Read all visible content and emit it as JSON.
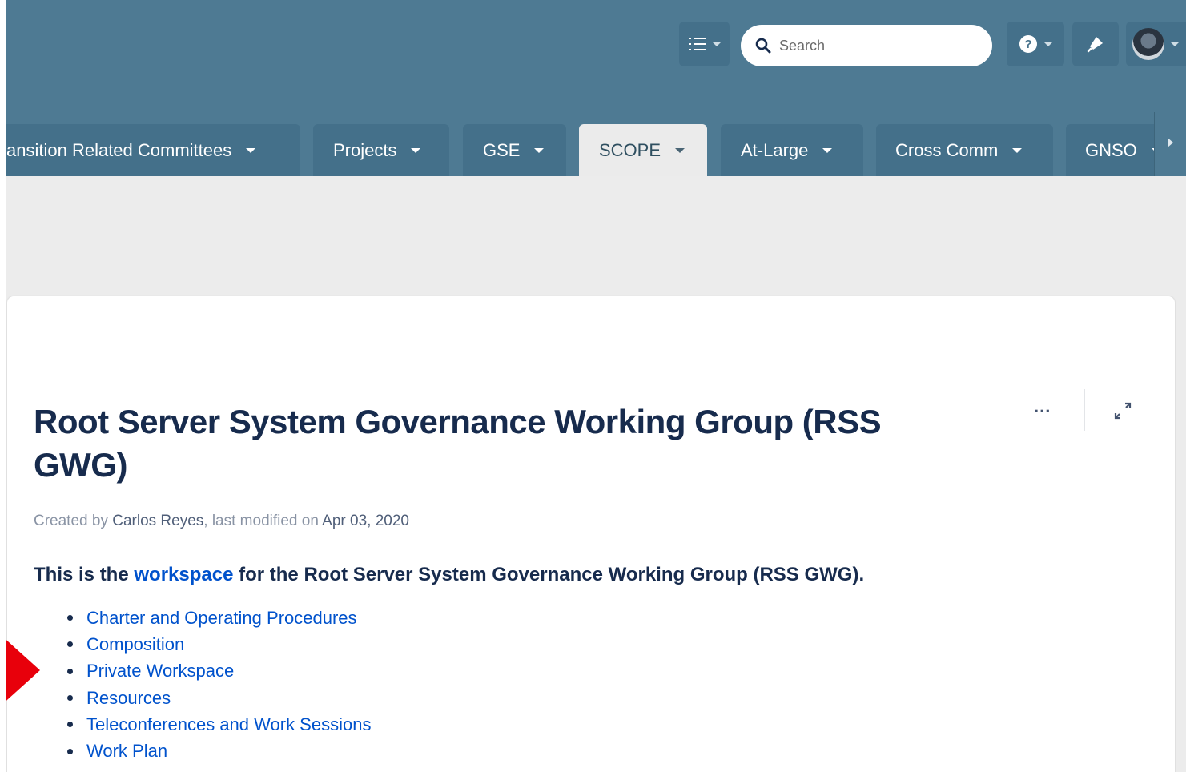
{
  "header": {
    "search_placeholder": "Search"
  },
  "tabs": [
    {
      "label": "ansition Related Committees",
      "active": false
    },
    {
      "label": "Projects",
      "active": false
    },
    {
      "label": "GSE",
      "active": false
    },
    {
      "label": "SCOPE",
      "active": true
    },
    {
      "label": "At-Large",
      "active": false
    },
    {
      "label": "Cross Comm",
      "active": false
    },
    {
      "label": "GNSO",
      "active": false
    }
  ],
  "page": {
    "title": "Root Server System Governance Working Group (RSS GWG)",
    "byline": {
      "created_by_label": "Created by",
      "author": "Carlos Reyes",
      "modified_label": ", last modified on",
      "date": "Apr 03, 2020"
    },
    "intro": {
      "prefix": "This is the",
      "link": "workspace",
      "suffix": "for the Root Server System Governance Working Group (RSS GWG)."
    },
    "links": [
      "Charter and Operating Procedures",
      "Composition",
      "Private Workspace",
      "Resources",
      "Teleconferences and Work Sessions",
      "Work Plan"
    ],
    "more_label": "..."
  },
  "colors": {
    "header_bg": "#4e7a93",
    "tab_bg": "#44708a",
    "link": "#0052cc",
    "title": "#172b4d",
    "annotation_arrow": "#e8000b"
  },
  "icons": {
    "toolbar": [
      "list-menu-icon",
      "search-icon",
      "help-icon",
      "notification-icon",
      "avatar"
    ],
    "page": [
      "more-actions-icon",
      "expand-icon"
    ],
    "annotation": "red-arrow-icon"
  }
}
